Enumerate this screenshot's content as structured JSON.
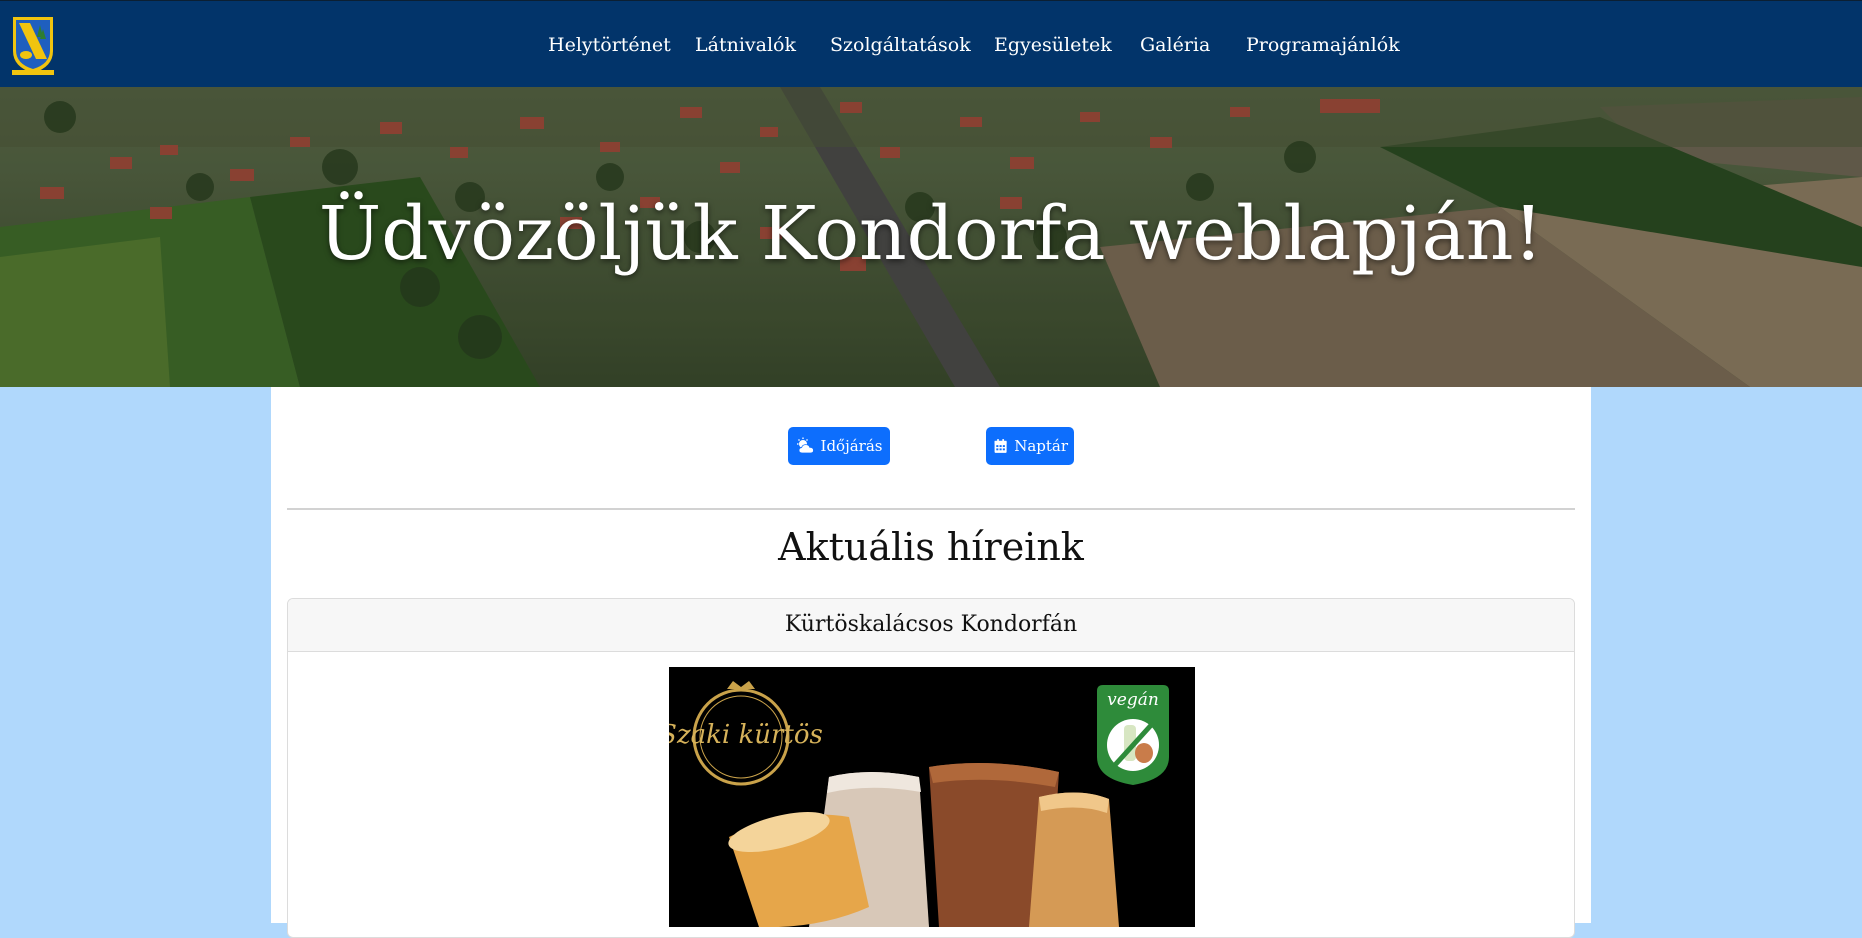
{
  "nav": {
    "logo_icon": "coat-of-arms-icon",
    "items": [
      {
        "label": "Helytörténet"
      },
      {
        "label": "Látnivalók"
      },
      {
        "label": "Szolgáltatások"
      },
      {
        "label": "Egyesületek"
      },
      {
        "label": "Galéria"
      },
      {
        "label": "Programajánlók"
      }
    ]
  },
  "hero": {
    "title": "Üdvözöljük Kondorfa weblapján!"
  },
  "buttons": {
    "weather": {
      "label": "Időjárás",
      "icon": "cloud-sun-icon"
    },
    "calendar": {
      "label": "Naptár",
      "icon": "calendar-icon"
    }
  },
  "news": {
    "heading": "Aktuális híreink",
    "articles": [
      {
        "title": "Kürtöskalácsos Kondorfán",
        "image_logo_text": "Szaki kürtös",
        "image_badge_text": "vegán"
      }
    ]
  },
  "colors": {
    "navbar": "#02346a",
    "page_background": "#b0d8fc",
    "button": "#0d6efd"
  }
}
